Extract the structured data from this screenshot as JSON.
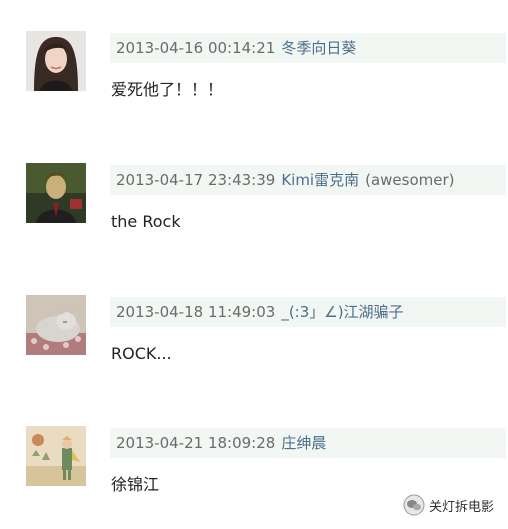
{
  "comments": [
    {
      "avatar": "woman-portrait-avatar",
      "time": "2013-04-16 00:14:21",
      "user": "冬季向日葵",
      "extra": "",
      "text": "爱死他了！！！"
    },
    {
      "avatar": "man-painting-avatar",
      "time": "2013-04-17 23:43:39",
      "user": "Kimi雷克南",
      "extra": "(awesomer)",
      "text": "the Rock"
    },
    {
      "avatar": "cat-avatar",
      "time": "2013-04-18 11:49:03",
      "user": "_(:3」∠)江湖骗子",
      "extra": "",
      "text": "ROCK..."
    },
    {
      "avatar": "little-prince-avatar",
      "time": "2013-04-21 18:09:28",
      "user": "庄绅晨",
      "extra": "",
      "text": "徐锦江"
    }
  ],
  "watermark": {
    "icon": "wechat-account-icon",
    "label": "关灯拆电影"
  }
}
